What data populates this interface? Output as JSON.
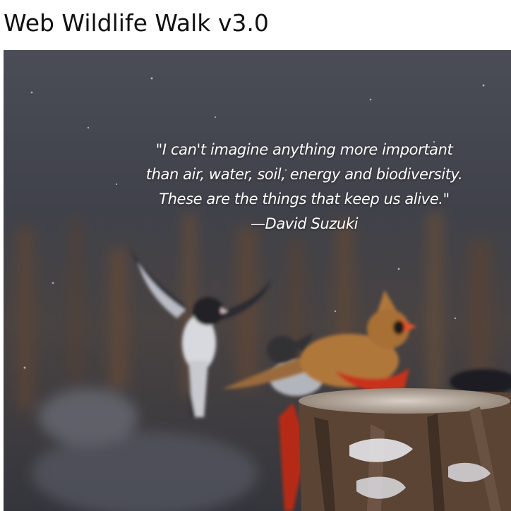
{
  "header": {
    "title": "Web Wildlife Walk v3.0"
  },
  "hero": {
    "image_subject": "junco in flight and northern cardinal perched on snowy tree stump",
    "quote": {
      "line1": "\"I can't imagine anything more important",
      "line2": "than air, water, soil, energy and biodiversity.",
      "line3": "These are the things that keep us alive.\"",
      "attribution": "—David Suzuki"
    }
  },
  "colors": {
    "title_text": "#111111",
    "quote_text": "#ffffff",
    "overlay": "#2b2d36",
    "cardinal_red": "#c8321b",
    "cardinal_tan": "#b0773a"
  }
}
